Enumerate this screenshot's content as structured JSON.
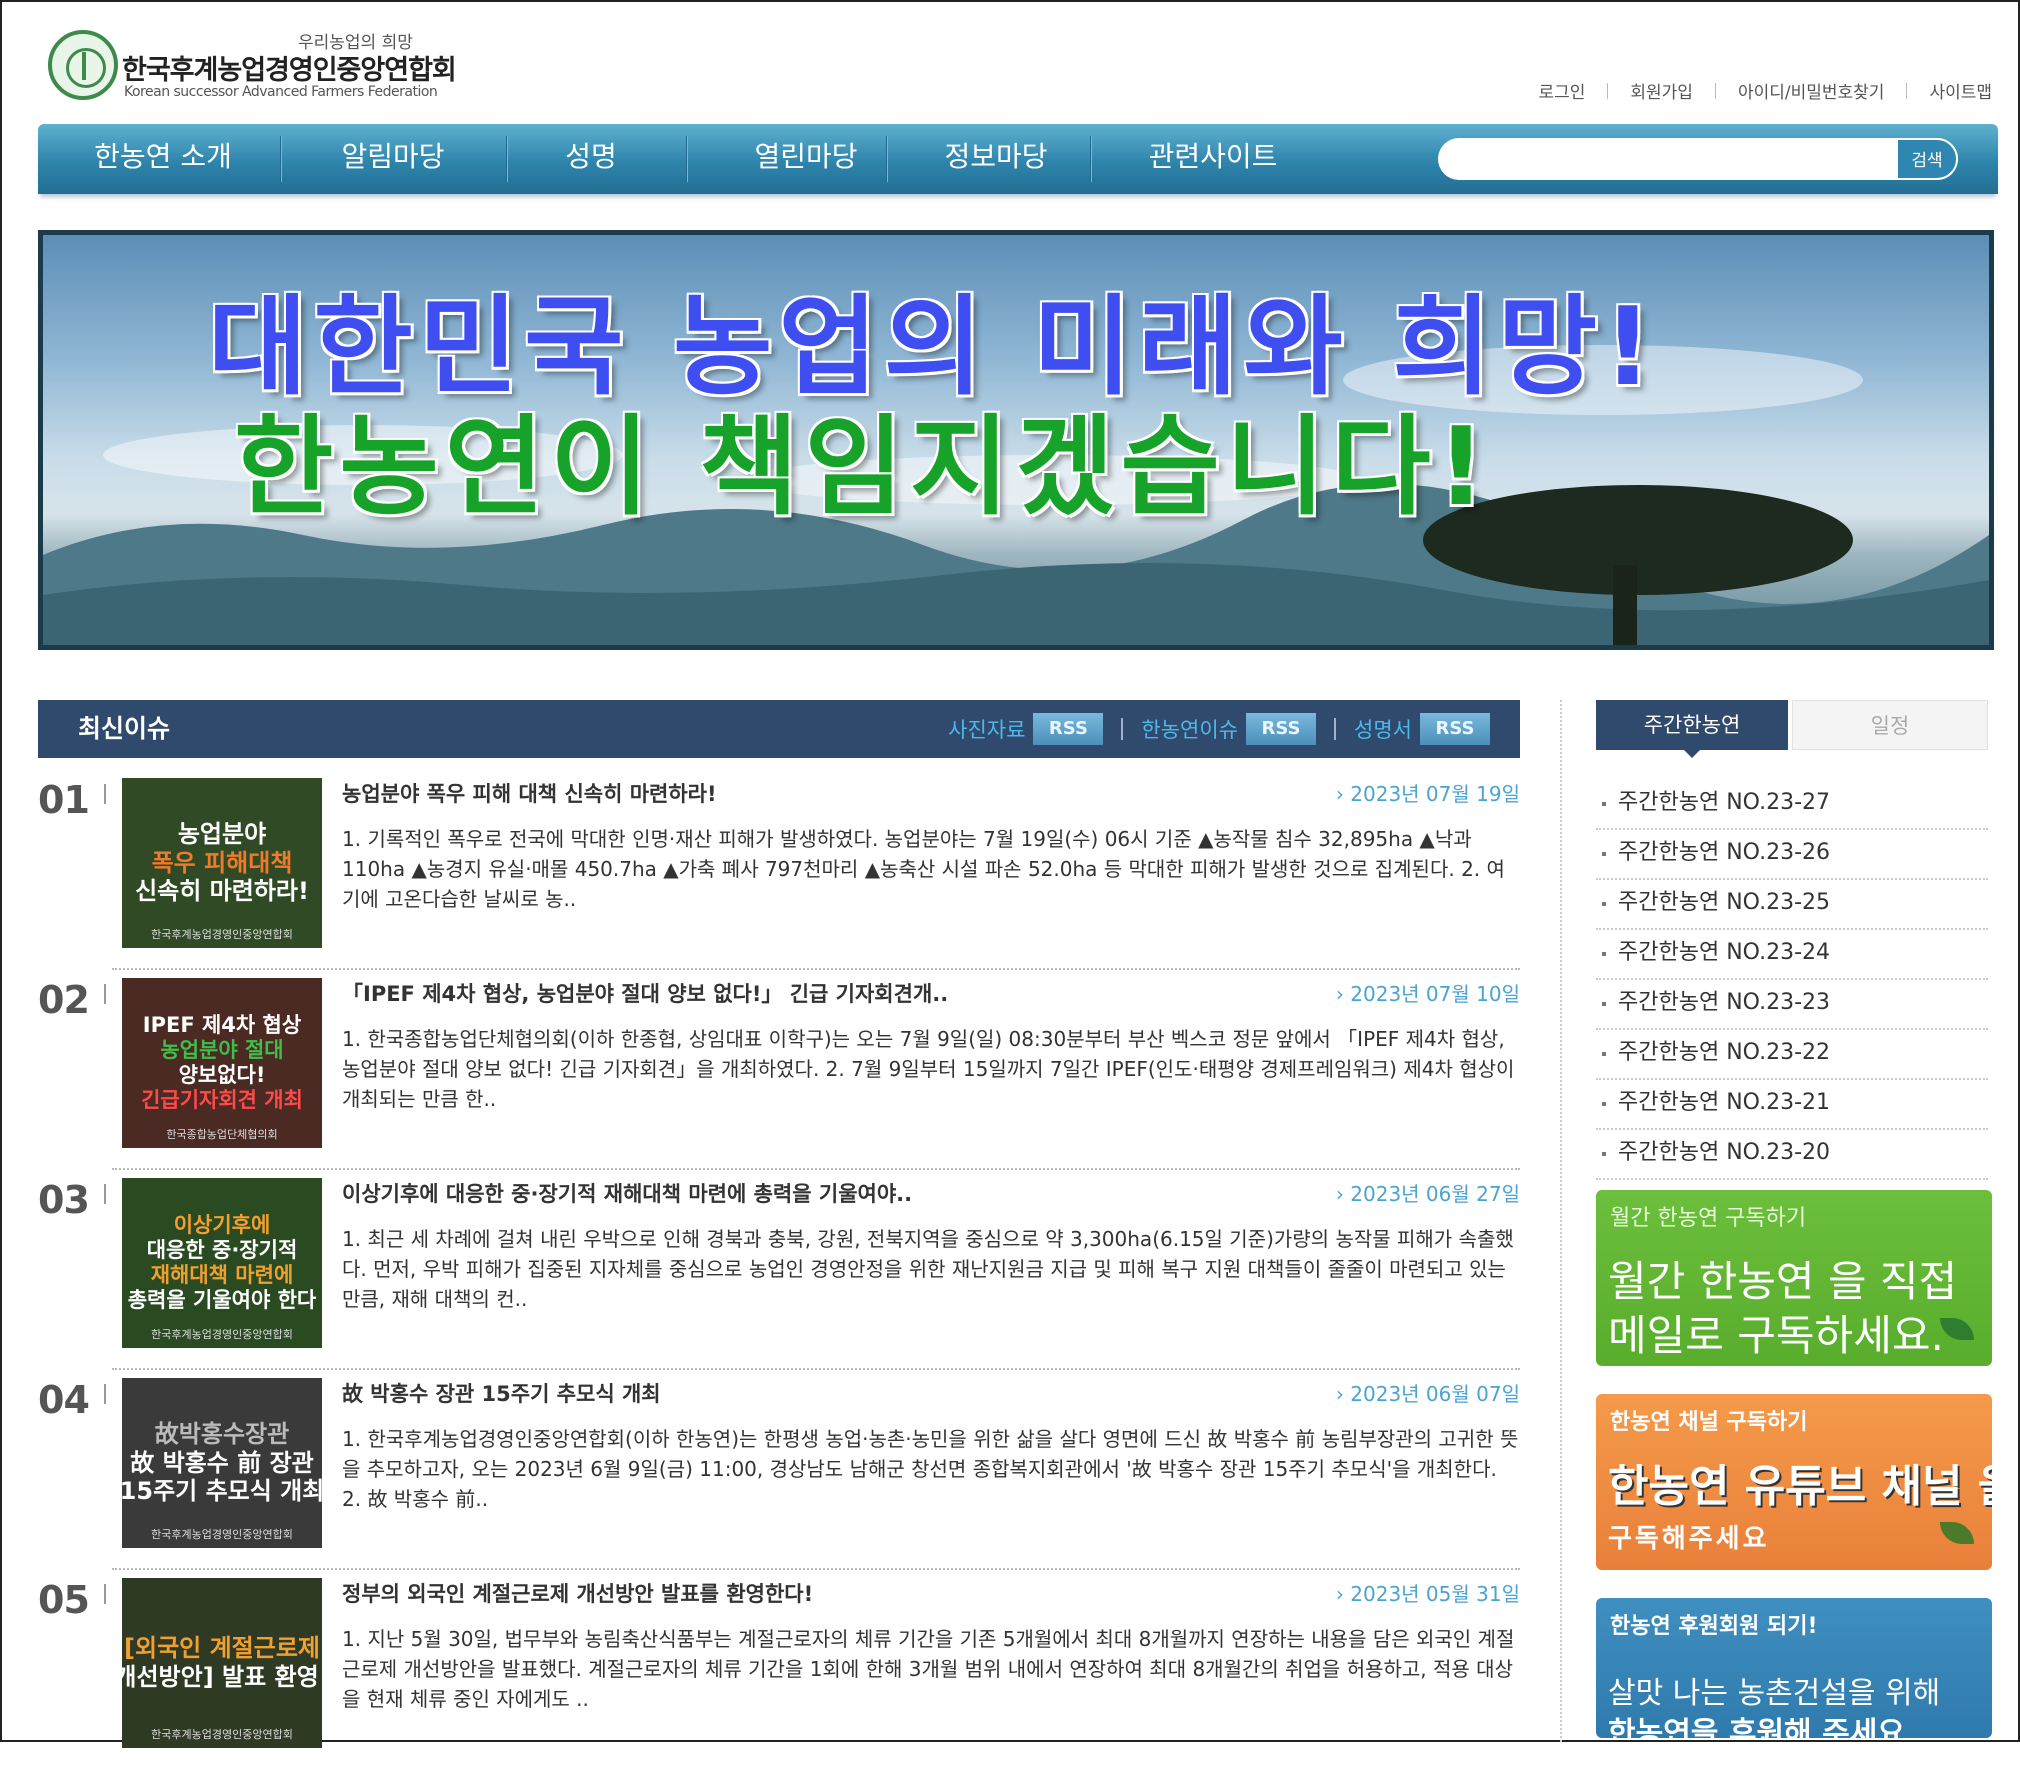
{
  "header": {
    "tagline": "우리농업의 희망",
    "org_name": "한국후계농업경영인중앙연합회",
    "org_name_en": "Korean successor Advanced Farmers Federation"
  },
  "util_links": [
    "로그인",
    "회원가입",
    "아이디/비밀번호찾기",
    "사이트맵"
  ],
  "nav": {
    "items": [
      "한농연 소개",
      "알림마당",
      "성명",
      "열린마당",
      "정보마당",
      "관련사이트"
    ],
    "search_placeholder": "",
    "search_button": "검색"
  },
  "banner": {
    "line1": "대한민국 농업의 미래와 희망!",
    "line2": "한농연이 책임지겠습니다!"
  },
  "issues": {
    "title": "최신이슈",
    "feeds": [
      {
        "label": "사진자료",
        "rss": "RSS"
      },
      {
        "label": "한농연이슈",
        "rss": "RSS"
      },
      {
        "label": "성명서",
        "rss": "RSS"
      }
    ],
    "articles": [
      {
        "num": "01",
        "title": "농업분야 폭우 피해 대책 신속히 마련하라!",
        "date": "2023년 07월 19일",
        "body": "1. 기록적인 폭우로 전국에 막대한 인명·재산 피해가 발생하였다. 농업분야는 7월 19일(수) 06시 기준 ▲농작물 침수 32,895ha ▲낙과 110ha ▲농경지 유실·매몰 450.7ha ▲가축 폐사 797천마리 ▲농축산 시설 파손 52.0ha 등 막대한 피해가 발생한 것으로 집계된다.   2. 여기에 고온다습한 날씨로 농..",
        "thumb_lines": [
          "농업분야",
          "폭우 피해대책",
          "신속히 마련하라!"
        ],
        "thumb_foot": "한국후계농업경영인중앙연합회",
        "thumb_bg": "#2f4a24",
        "thumb_colors": [
          "#ffffff",
          "#f07a2a",
          "#ffffff"
        ]
      },
      {
        "num": "02",
        "title": "「IPEF 제4차 협상, 농업분야 절대 양보 없다!」 긴급 기자회견개..",
        "date": "2023년 07월 10일",
        "body": "1. 한국종합농업단체협의회(이하 한종협, 상임대표 이학구)는 오는 7월 9일(일) 08:30분부터 부산 벡스코 정문 앞에서 「IPEF 제4차 협상, 농업분야 절대 양보 없다! 긴급 기자회견」을 개최하였다.    2. 7월 9일부터 15일까지 7일간 IPEF(인도·태평양 경제프레임워크) 제4차 협상이 개최되는 만큼 한..",
        "thumb_lines": [
          "IPEF 제4차 협상",
          "농업분야 절대",
          "양보없다!",
          "긴급기자회견 개최"
        ],
        "thumb_foot": "한국종합농업단체협의회",
        "thumb_bg": "#4a2a22",
        "thumb_colors": [
          "#ffffff",
          "#3fbf4a",
          "#ffffff",
          "#ff4a4a"
        ]
      },
      {
        "num": "03",
        "title": "이상기후에 대응한 중·장기적 재해대책 마련에 총력을 기울여야..",
        "date": "2023년 06월 27일",
        "body": "1. 최근 세 차례에 걸쳐 내린 우박으로 인해 경북과 충북, 강원, 전북지역을 중심으로 약 3,300ha(6.15일 기준)가량의 농작물 피해가 속출했다. 먼저, 우박 피해가 집중된 지자체를 중심으로 농업인 경영안정을 위한 재난지원금 지급 및 피해 복구 지원 대책들이 줄줄이 마련되고 있는 만큼, 재해 대책의 컨..",
        "thumb_lines": [
          "이상기후에",
          "대응한 중·장기적",
          "재해대책 마련에",
          "총력을 기울여야 한다"
        ],
        "thumb_foot": "한국후계농업경영인중앙연합회",
        "thumb_bg": "#2a4a22",
        "thumb_colors": [
          "#f0a030",
          "#ffffff",
          "#f0a030",
          "#ffffff"
        ]
      },
      {
        "num": "04",
        "title": "故 박홍수 장관 15주기 추모식 개최",
        "date": "2023년 06월 07일",
        "body": "1. 한국후계농업경영인중앙연합회(이하 한농연)는 한평생 농업·농촌·농민을 위한 삶을 살다 영면에 드신 故 박홍수 前 농림부장관의 고귀한 뜻을 추모하고자, 오는 2023년 6월 9일(금) 11:00, 경상남도 남해군 창선면 종합복지회관에서 '故 박홍수 장관 15주기 추모식'을 개최한다.   2. 故 박홍수 前..",
        "thumb_lines": [
          "故박홍수장관",
          "故 박홍수 前 장관",
          "15주기 추모식 개최"
        ],
        "thumb_foot": "한국후계농업경영인중앙연합회",
        "thumb_bg": "#3a3a3a",
        "thumb_colors": [
          "#bbbbbb",
          "#ffffff",
          "#ffffff"
        ]
      },
      {
        "num": "05",
        "title": "정부의 외국인 계절근로제 개선방안 발표를 환영한다!",
        "date": "2023년 05월 31일",
        "body": "1. 지난 5월 30일, 법무부와 농림축산식품부는 계절근로자의 체류 기간을 기존 5개월에서 최대 8개월까지 연장하는 내용을 담은 외국인 계절근로제 개선방안을 발표했다. 계절근로자의 체류 기간을 1회에 한해 3개월 범위 내에서 연장하여 최대 8개월간의 취업을 허용하고, 적용 대상을 현재 체류 중인 자에게도 ..",
        "thumb_lines": [
          "[외국인 계절근로제",
          "개선방안] 발표 환영!"
        ],
        "thumb_foot": "한국후계농업경영인중앙연합회",
        "thumb_bg": "#2f3a24",
        "thumb_colors": [
          "#f0a030",
          "#ffffff"
        ]
      }
    ]
  },
  "sidebar": {
    "tabs": [
      "주간한농연",
      "일정"
    ],
    "weekly": [
      "주간한농연 NO.23-27",
      "주간한농연 NO.23-26",
      "주간한농연 NO.23-25",
      "주간한농연 NO.23-24",
      "주간한농연 NO.23-23",
      "주간한농연 NO.23-22",
      "주간한농연 NO.23-21",
      "주간한농연 NO.23-20"
    ],
    "promo_monthly": {
      "head": "월간 한농연 구독하기",
      "big1": "월간 한농연 을 직접",
      "big2": "메일로 구독하세요."
    },
    "promo_youtube": {
      "head": "한농연 채널 구독하기",
      "big1": "한농연 유튜브 채널 을",
      "big2": "구독해주세요"
    },
    "promo_support": {
      "head": "한농연 후원회원 되기!",
      "big1": "살맛 나는 농촌건설을 위해",
      "big2": "한농연을 후원해 주세요"
    }
  }
}
